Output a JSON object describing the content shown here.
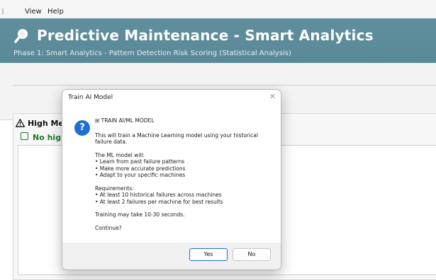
{
  "menu": {
    "items": [
      "View",
      "Help"
    ]
  },
  "header": {
    "title": "Predictive Maintenance - Smart Analytics",
    "subtitle": "Phase 1: Smart Analytics - Pattern Detection  Risk Scoring (Statistical Analysis)",
    "icon": "search-icon",
    "color": "#5f8e9c"
  },
  "panel": {
    "alert_heading": "High  Me",
    "ok_text": "No high",
    "warn_icon": "warning-icon",
    "check_icon": "check-icon"
  },
  "dialog": {
    "title": "Train AI Model",
    "close": "✕",
    "icon": "info-icon",
    "icon_glyph": "?",
    "header_line": "⊞ TRAIN AI/ML MODEL",
    "paragraphs": [
      "This will train a Machine Learning model using your historical\nfailure data.",
      "The ML model will:\n• Learn from past failure patterns\n• Make more accurate predictions\n• Adapt to your specific machines",
      "Requirements:\n• At least 10 historical failures across machines\n• At least 2 failures per machine for best results",
      "Training may take 10-30 seconds.",
      "Continue?"
    ],
    "yes_label": "Yes",
    "no_label": "No",
    "accent": "#1e6fd0"
  }
}
